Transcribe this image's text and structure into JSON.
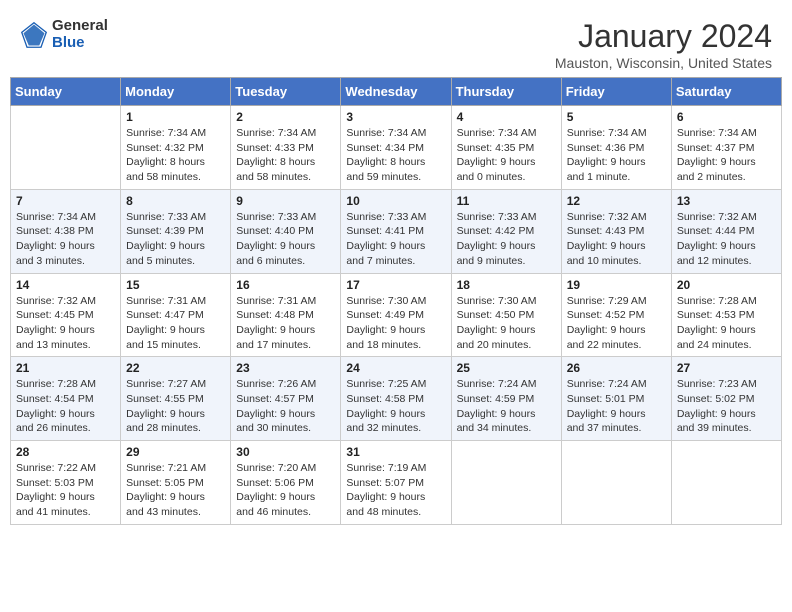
{
  "header": {
    "logo_general": "General",
    "logo_blue": "Blue",
    "month_title": "January 2024",
    "location": "Mauston, Wisconsin, United States"
  },
  "days_of_week": [
    "Sunday",
    "Monday",
    "Tuesday",
    "Wednesday",
    "Thursday",
    "Friday",
    "Saturday"
  ],
  "weeks": [
    [
      {
        "day": "",
        "content": ""
      },
      {
        "day": "1",
        "content": "Sunrise: 7:34 AM\nSunset: 4:32 PM\nDaylight: 8 hours\nand 58 minutes."
      },
      {
        "day": "2",
        "content": "Sunrise: 7:34 AM\nSunset: 4:33 PM\nDaylight: 8 hours\nand 58 minutes."
      },
      {
        "day": "3",
        "content": "Sunrise: 7:34 AM\nSunset: 4:34 PM\nDaylight: 8 hours\nand 59 minutes."
      },
      {
        "day": "4",
        "content": "Sunrise: 7:34 AM\nSunset: 4:35 PM\nDaylight: 9 hours\nand 0 minutes."
      },
      {
        "day": "5",
        "content": "Sunrise: 7:34 AM\nSunset: 4:36 PM\nDaylight: 9 hours\nand 1 minute."
      },
      {
        "day": "6",
        "content": "Sunrise: 7:34 AM\nSunset: 4:37 PM\nDaylight: 9 hours\nand 2 minutes."
      }
    ],
    [
      {
        "day": "7",
        "content": "Sunrise: 7:34 AM\nSunset: 4:38 PM\nDaylight: 9 hours\nand 3 minutes."
      },
      {
        "day": "8",
        "content": "Sunrise: 7:33 AM\nSunset: 4:39 PM\nDaylight: 9 hours\nand 5 minutes."
      },
      {
        "day": "9",
        "content": "Sunrise: 7:33 AM\nSunset: 4:40 PM\nDaylight: 9 hours\nand 6 minutes."
      },
      {
        "day": "10",
        "content": "Sunrise: 7:33 AM\nSunset: 4:41 PM\nDaylight: 9 hours\nand 7 minutes."
      },
      {
        "day": "11",
        "content": "Sunrise: 7:33 AM\nSunset: 4:42 PM\nDaylight: 9 hours\nand 9 minutes."
      },
      {
        "day": "12",
        "content": "Sunrise: 7:32 AM\nSunset: 4:43 PM\nDaylight: 9 hours\nand 10 minutes."
      },
      {
        "day": "13",
        "content": "Sunrise: 7:32 AM\nSunset: 4:44 PM\nDaylight: 9 hours\nand 12 minutes."
      }
    ],
    [
      {
        "day": "14",
        "content": "Sunrise: 7:32 AM\nSunset: 4:45 PM\nDaylight: 9 hours\nand 13 minutes."
      },
      {
        "day": "15",
        "content": "Sunrise: 7:31 AM\nSunset: 4:47 PM\nDaylight: 9 hours\nand 15 minutes."
      },
      {
        "day": "16",
        "content": "Sunrise: 7:31 AM\nSunset: 4:48 PM\nDaylight: 9 hours\nand 17 minutes."
      },
      {
        "day": "17",
        "content": "Sunrise: 7:30 AM\nSunset: 4:49 PM\nDaylight: 9 hours\nand 18 minutes."
      },
      {
        "day": "18",
        "content": "Sunrise: 7:30 AM\nSunset: 4:50 PM\nDaylight: 9 hours\nand 20 minutes."
      },
      {
        "day": "19",
        "content": "Sunrise: 7:29 AM\nSunset: 4:52 PM\nDaylight: 9 hours\nand 22 minutes."
      },
      {
        "day": "20",
        "content": "Sunrise: 7:28 AM\nSunset: 4:53 PM\nDaylight: 9 hours\nand 24 minutes."
      }
    ],
    [
      {
        "day": "21",
        "content": "Sunrise: 7:28 AM\nSunset: 4:54 PM\nDaylight: 9 hours\nand 26 minutes."
      },
      {
        "day": "22",
        "content": "Sunrise: 7:27 AM\nSunset: 4:55 PM\nDaylight: 9 hours\nand 28 minutes."
      },
      {
        "day": "23",
        "content": "Sunrise: 7:26 AM\nSunset: 4:57 PM\nDaylight: 9 hours\nand 30 minutes."
      },
      {
        "day": "24",
        "content": "Sunrise: 7:25 AM\nSunset: 4:58 PM\nDaylight: 9 hours\nand 32 minutes."
      },
      {
        "day": "25",
        "content": "Sunrise: 7:24 AM\nSunset: 4:59 PM\nDaylight: 9 hours\nand 34 minutes."
      },
      {
        "day": "26",
        "content": "Sunrise: 7:24 AM\nSunset: 5:01 PM\nDaylight: 9 hours\nand 37 minutes."
      },
      {
        "day": "27",
        "content": "Sunrise: 7:23 AM\nSunset: 5:02 PM\nDaylight: 9 hours\nand 39 minutes."
      }
    ],
    [
      {
        "day": "28",
        "content": "Sunrise: 7:22 AM\nSunset: 5:03 PM\nDaylight: 9 hours\nand 41 minutes."
      },
      {
        "day": "29",
        "content": "Sunrise: 7:21 AM\nSunset: 5:05 PM\nDaylight: 9 hours\nand 43 minutes."
      },
      {
        "day": "30",
        "content": "Sunrise: 7:20 AM\nSunset: 5:06 PM\nDaylight: 9 hours\nand 46 minutes."
      },
      {
        "day": "31",
        "content": "Sunrise: 7:19 AM\nSunset: 5:07 PM\nDaylight: 9 hours\nand 48 minutes."
      },
      {
        "day": "",
        "content": ""
      },
      {
        "day": "",
        "content": ""
      },
      {
        "day": "",
        "content": ""
      }
    ]
  ]
}
